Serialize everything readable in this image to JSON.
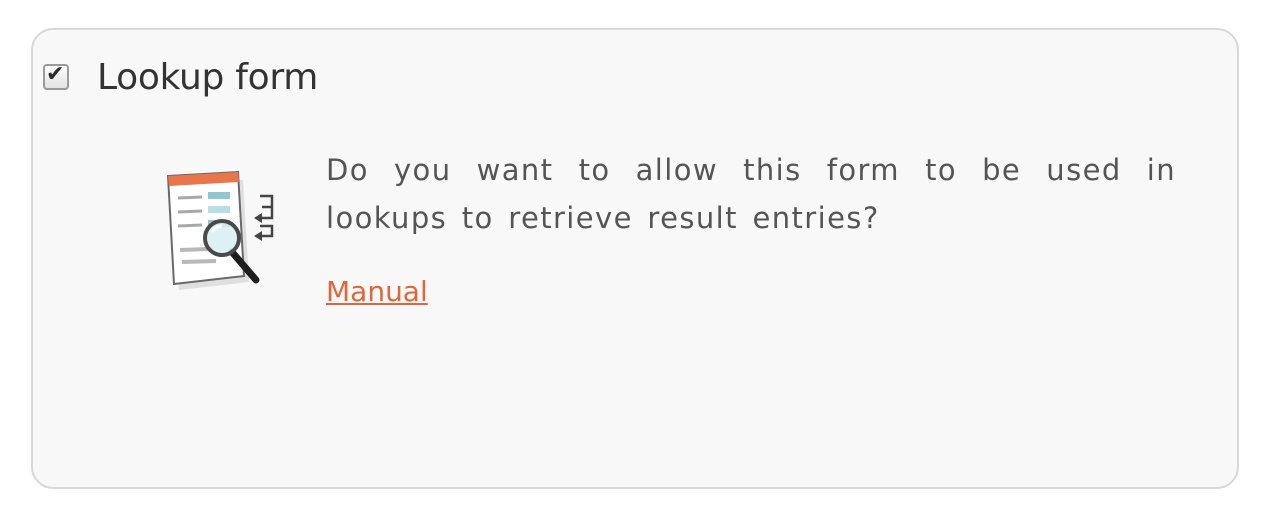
{
  "lookup": {
    "checked": true,
    "checkbox_glyph": "✔",
    "title": "Lookup form",
    "icon": "lookup-form-magnifier-icon",
    "description": "Do you want to allow this form to be used in lookups to retrieve result entries?",
    "manual_link": "Manual"
  },
  "colors": {
    "panel_background": "#f8f8f8",
    "panel_border": "#d8d8d8",
    "text": "#555555",
    "title": "#333333",
    "link": "#e0663c"
  }
}
